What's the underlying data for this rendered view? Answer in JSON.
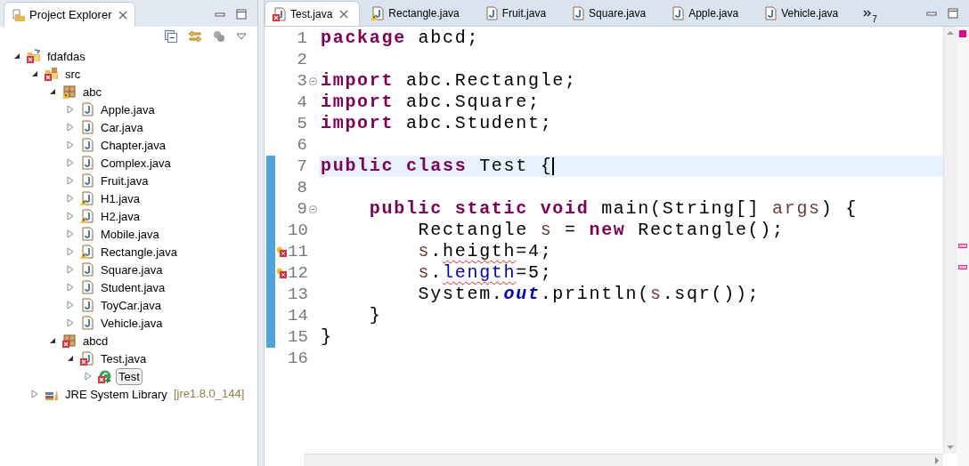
{
  "explorer": {
    "title": "Project Explorer",
    "tree": [
      {
        "label": "fdafdas",
        "kind": "project",
        "error": true,
        "warning": false,
        "expanded": true,
        "selected": false,
        "children": [
          {
            "label": "src",
            "kind": "source-folder",
            "error": true,
            "warning": false,
            "expanded": true,
            "selected": false,
            "children": [
              {
                "label": "abc",
                "kind": "package",
                "error": false,
                "warning": true,
                "expanded": true,
                "selected": false,
                "children": [
                  {
                    "label": "Apple.java",
                    "kind": "java-file",
                    "error": false,
                    "warning": false,
                    "expanded": false,
                    "selected": false
                  },
                  {
                    "label": "Car.java",
                    "kind": "java-file",
                    "error": false,
                    "warning": false,
                    "expanded": false,
                    "selected": false
                  },
                  {
                    "label": "Chapter.java",
                    "kind": "java-file",
                    "error": false,
                    "warning": false,
                    "expanded": false,
                    "selected": false
                  },
                  {
                    "label": "Complex.java",
                    "kind": "java-file",
                    "error": false,
                    "warning": false,
                    "expanded": false,
                    "selected": false
                  },
                  {
                    "label": "Fruit.java",
                    "kind": "java-file",
                    "error": false,
                    "warning": false,
                    "expanded": false,
                    "selected": false
                  },
                  {
                    "label": "H1.java",
                    "kind": "java-file",
                    "error": false,
                    "warning": true,
                    "expanded": false,
                    "selected": false
                  },
                  {
                    "label": "H2.java",
                    "kind": "java-file",
                    "error": false,
                    "warning": true,
                    "expanded": false,
                    "selected": false
                  },
                  {
                    "label": "Mobile.java",
                    "kind": "java-file",
                    "error": false,
                    "warning": false,
                    "expanded": false,
                    "selected": false
                  },
                  {
                    "label": "Rectangle.java",
                    "kind": "java-file",
                    "error": false,
                    "warning": true,
                    "expanded": false,
                    "selected": false
                  },
                  {
                    "label": "Square.java",
                    "kind": "java-file",
                    "error": false,
                    "warning": false,
                    "expanded": false,
                    "selected": false
                  },
                  {
                    "label": "Student.java",
                    "kind": "java-file",
                    "error": false,
                    "warning": false,
                    "expanded": false,
                    "selected": false
                  },
                  {
                    "label": "ToyCar.java",
                    "kind": "java-file",
                    "error": false,
                    "warning": false,
                    "expanded": false,
                    "selected": false
                  },
                  {
                    "label": "Vehicle.java",
                    "kind": "java-file",
                    "error": false,
                    "warning": false,
                    "expanded": false,
                    "selected": false
                  }
                ]
              },
              {
                "label": "abcd",
                "kind": "package",
                "error": true,
                "warning": false,
                "expanded": true,
                "selected": false,
                "children": [
                  {
                    "label": "Test.java",
                    "kind": "java-file",
                    "error": true,
                    "warning": false,
                    "expanded": true,
                    "selected": false,
                    "children": [
                      {
                        "label": "Test",
                        "kind": "class",
                        "error": true,
                        "warning": false,
                        "expanded": false,
                        "selected": true
                      }
                    ]
                  }
                ]
              }
            ]
          },
          {
            "label": "JRE System Library",
            "detail": "[jre1.8.0_144]",
            "kind": "library",
            "error": false,
            "warning": false,
            "expanded": false,
            "selected": false
          }
        ]
      }
    ]
  },
  "editor": {
    "tabs": [
      {
        "label": "Test.java",
        "selected": true,
        "error": true,
        "warning": false
      },
      {
        "label": "Rectangle.java",
        "selected": false,
        "error": false,
        "warning": true
      },
      {
        "label": "Fruit.java",
        "selected": false,
        "error": false,
        "warning": false
      },
      {
        "label": "Square.java",
        "selected": false,
        "error": false,
        "warning": false
      },
      {
        "label": "Apple.java",
        "selected": false,
        "error": false,
        "warning": false
      },
      {
        "label": "Vehicle.java",
        "selected": false,
        "error": false,
        "warning": false
      }
    ],
    "overflow_count": "7",
    "lines": [
      {
        "number": "1",
        "current": false,
        "changed": false,
        "fold": false,
        "error": false,
        "tokens": [
          {
            "kind": "keyword",
            "text": "package"
          },
          {
            "kind": "plain",
            "text": " abcd;"
          }
        ]
      },
      {
        "number": "2",
        "current": false,
        "changed": false,
        "fold": false,
        "error": false
      },
      {
        "number": "3",
        "current": false,
        "changed": false,
        "fold": true,
        "error": false,
        "tokens": [
          {
            "kind": "keyword",
            "text": "import"
          },
          {
            "kind": "plain",
            "text": " abc.Rectangle;"
          }
        ]
      },
      {
        "number": "4",
        "current": false,
        "changed": false,
        "fold": false,
        "error": false,
        "tokens": [
          {
            "kind": "keyword",
            "text": "import"
          },
          {
            "kind": "plain",
            "text": " abc.Square;"
          }
        ]
      },
      {
        "number": "5",
        "current": false,
        "changed": false,
        "fold": false,
        "error": false,
        "tokens": [
          {
            "kind": "keyword",
            "text": "import"
          },
          {
            "kind": "plain",
            "text": " abc.Student;"
          }
        ]
      },
      {
        "number": "6",
        "current": false,
        "changed": false,
        "fold": false,
        "error": false
      },
      {
        "number": "7",
        "current": true,
        "changed": true,
        "fold": false,
        "error": false,
        "tokens": [
          {
            "kind": "keyword",
            "text": "public"
          },
          {
            "kind": "keyword",
            "text": " class"
          },
          {
            "kind": "plain",
            "text": " Test {"
          }
        ]
      },
      {
        "number": "8",
        "current": false,
        "changed": true,
        "fold": false,
        "error": false
      },
      {
        "number": "9",
        "current": false,
        "changed": true,
        "fold": true,
        "error": false,
        "tokens": [
          {
            "kind": "keyword",
            "text": "    public"
          },
          {
            "kind": "keyword",
            "text": " static"
          },
          {
            "kind": "keyword",
            "text": " void"
          },
          {
            "kind": "plain",
            "text": " main(String[] "
          },
          {
            "kind": "local",
            "text": "args"
          },
          {
            "kind": "plain",
            "text": ") {"
          }
        ]
      },
      {
        "number": "10",
        "current": false,
        "changed": true,
        "fold": false,
        "error": false,
        "tokens": [
          {
            "kind": "plain",
            "text": "        Rectangle "
          },
          {
            "kind": "local",
            "text": "s"
          },
          {
            "kind": "plain",
            "text": " = "
          },
          {
            "kind": "keyword",
            "text": "new"
          },
          {
            "kind": "plain",
            "text": " Rectangle();"
          }
        ]
      },
      {
        "number": "11",
        "current": false,
        "changed": true,
        "fold": false,
        "error": true,
        "tokens": [
          {
            "kind": "local",
            "text": "        s"
          },
          {
            "kind": "plain",
            "text": "."
          },
          {
            "kind": "error",
            "text": "heigth"
          },
          {
            "kind": "plain",
            "text": "=4;"
          }
        ]
      },
      {
        "number": "12",
        "current": false,
        "changed": true,
        "fold": false,
        "error": true,
        "tokens": [
          {
            "kind": "local",
            "text": "        s"
          },
          {
            "kind": "plain",
            "text": "."
          },
          {
            "kind": "field-error",
            "text": "length"
          },
          {
            "kind": "plain",
            "text": "=5;"
          }
        ]
      },
      {
        "number": "13",
        "current": false,
        "changed": true,
        "fold": false,
        "error": false,
        "tokens": [
          {
            "kind": "plain",
            "text": "        System."
          },
          {
            "kind": "static-field",
            "text": "out"
          },
          {
            "kind": "plain",
            "text": ".println("
          },
          {
            "kind": "local",
            "text": "s"
          },
          {
            "kind": "plain",
            "text": ".sqr());"
          }
        ]
      },
      {
        "number": "14",
        "current": false,
        "changed": true,
        "fold": false,
        "error": false,
        "tokens": [
          {
            "kind": "plain",
            "text": "    }"
          }
        ]
      },
      {
        "number": "15",
        "current": false,
        "changed": true,
        "fold": false,
        "error": false,
        "tokens": [
          {
            "kind": "plain",
            "text": "}"
          }
        ]
      },
      {
        "number": "16",
        "current": false,
        "changed": false,
        "fold": false,
        "error": false
      }
    ]
  }
}
